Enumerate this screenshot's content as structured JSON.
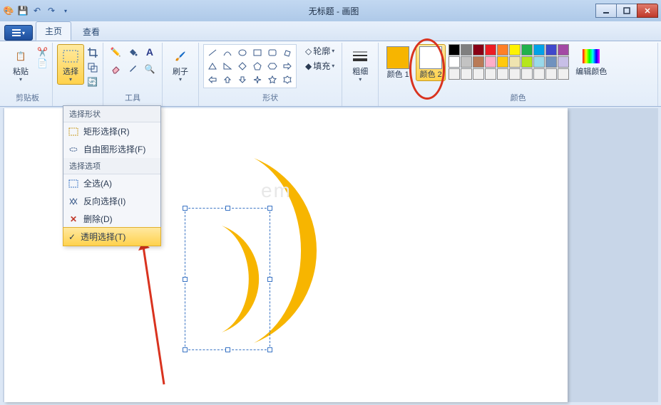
{
  "window": {
    "title": "无标题 - 画图"
  },
  "tabs": {
    "home": "主页",
    "view": "查看"
  },
  "groups": {
    "clipboard": {
      "label": "剪贴板",
      "paste": "粘贴"
    },
    "image": {
      "select": "选择"
    },
    "tools": {
      "label": "工具"
    },
    "brushes": {
      "label": "刷子"
    },
    "shapes": {
      "label": "形状",
      "outline": "轮廓",
      "fill": "填充"
    },
    "size": {
      "label": "粗细"
    },
    "colors": {
      "label": "颜色",
      "color1": "颜色 1",
      "color2": "颜色 2",
      "edit": "编辑颜色"
    }
  },
  "dropdown": {
    "section1": "选择形状",
    "rect": "矩形选择(R)",
    "free": "自由图形选择(F)",
    "section2": "选择选项",
    "all": "全选(A)",
    "invert": "反向选择(I)",
    "delete": "删除(D)",
    "transparent": "透明选择(T)"
  },
  "palette_row1": [
    "#000000",
    "#7f7f7f",
    "#880015",
    "#ed1c24",
    "#ff7f27",
    "#fff200",
    "#22b14c",
    "#00a2e8",
    "#3f48cc",
    "#a349a4"
  ],
  "palette_row2": [
    "#ffffff",
    "#c3c3c3",
    "#b97a57",
    "#ffaec9",
    "#ffc90e",
    "#efe4b0",
    "#b5e61d",
    "#99d9ea",
    "#7092be",
    "#c8bfe7"
  ],
  "palette_row3": [
    "#f0f0f0",
    "#f0f0f0",
    "#f0f0f0",
    "#f0f0f0",
    "#f0f0f0",
    "#f0f0f0",
    "#f0f0f0",
    "#f0f0f0",
    "#f0f0f0",
    "#f0f0f0"
  ],
  "color1": "#f7b500",
  "color2": "#ffffff",
  "watermark": "em"
}
